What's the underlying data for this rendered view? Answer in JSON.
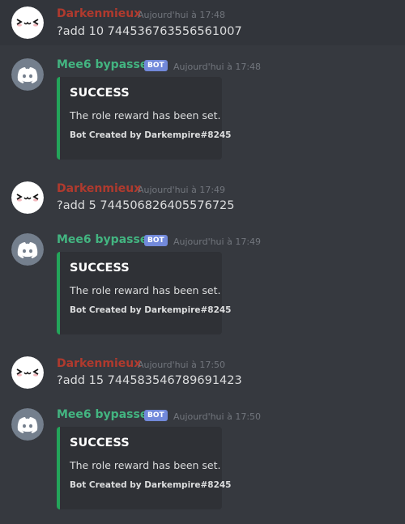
{
  "messages": [
    {
      "author": "Darkenmieux",
      "time": "Aujourd'hui à 17:48",
      "text": "?add 10 744536763556561007"
    },
    {
      "author": "Mee6 bypasser",
      "bot_tag": "BOT",
      "time": "Aujourd'hui à 17:48",
      "embed": {
        "title": "SUCCESS",
        "description": "The role reward has been set.",
        "footer": "Bot Created by Darkempire#8245"
      }
    },
    {
      "author": "Darkenmieux",
      "time": "Aujourd'hui à 17:49",
      "text": "?add 5 744506826405576725"
    },
    {
      "author": "Mee6 bypasser",
      "bot_tag": "BOT",
      "time": "Aujourd'hui à 17:49",
      "embed": {
        "title": "SUCCESS",
        "description": "The role reward has been set.",
        "footer": "Bot Created by Darkempire#8245"
      }
    },
    {
      "author": "Darkenmieux",
      "time": "Aujourd'hui à 17:50",
      "text": "?add 15 744583546789691423"
    },
    {
      "author": "Mee6 bypasser",
      "bot_tag": "BOT",
      "time": "Aujourd'hui à 17:50",
      "embed": {
        "title": "SUCCESS",
        "description": "The role reward has been set.",
        "footer": "Bot Created by Darkempire#8245"
      }
    }
  ],
  "colors": {
    "user_name": "#b03a2e",
    "bot_name": "#43b581",
    "embed_accent": "#23a55a",
    "bot_tag": "#7289da",
    "background": "#36393f"
  },
  "icons": {
    "user_avatar": "cat-face-avatar-icon",
    "bot_avatar": "discord-logo-avatar-icon"
  }
}
